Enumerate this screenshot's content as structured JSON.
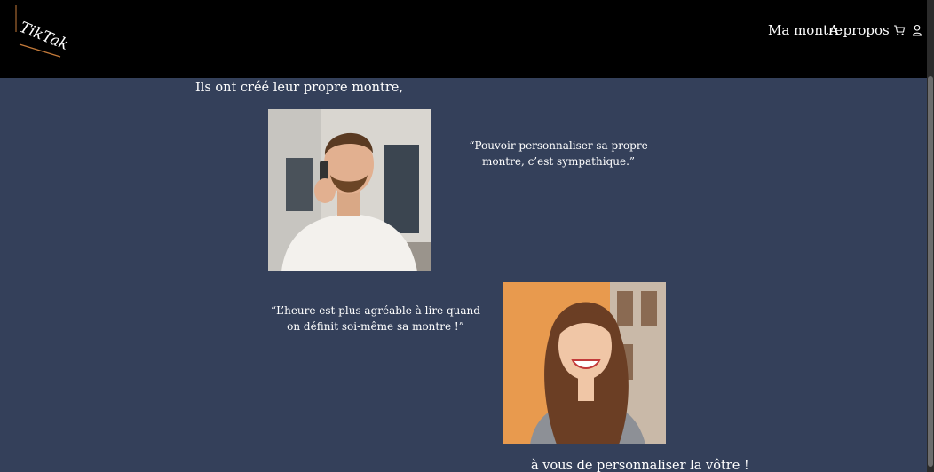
{
  "header": {
    "logo_text": "TikTak",
    "nav": [
      {
        "label": "Ma montre"
      },
      {
        "label": "A propos"
      }
    ],
    "icons": [
      "cart-icon",
      "user-icon"
    ]
  },
  "main": {
    "intro": "Ils ont créé leur propre montre,",
    "testimonials": [
      {
        "quote": "“Pouvoir personnaliser sa propre montre, c’est sympathique.”",
        "photo": "man-on-phone"
      },
      {
        "quote": "“L’heure est plus agréable à lire quand on définit soi-même sa montre !”",
        "photo": "smiling-woman"
      }
    ],
    "cta": "à vous de personnaliser la vôtre !"
  },
  "colors": {
    "header_bg": "#000000",
    "page_bg": "#34405a",
    "text": "#ffffff",
    "logo_accent": "#c47a3a"
  }
}
